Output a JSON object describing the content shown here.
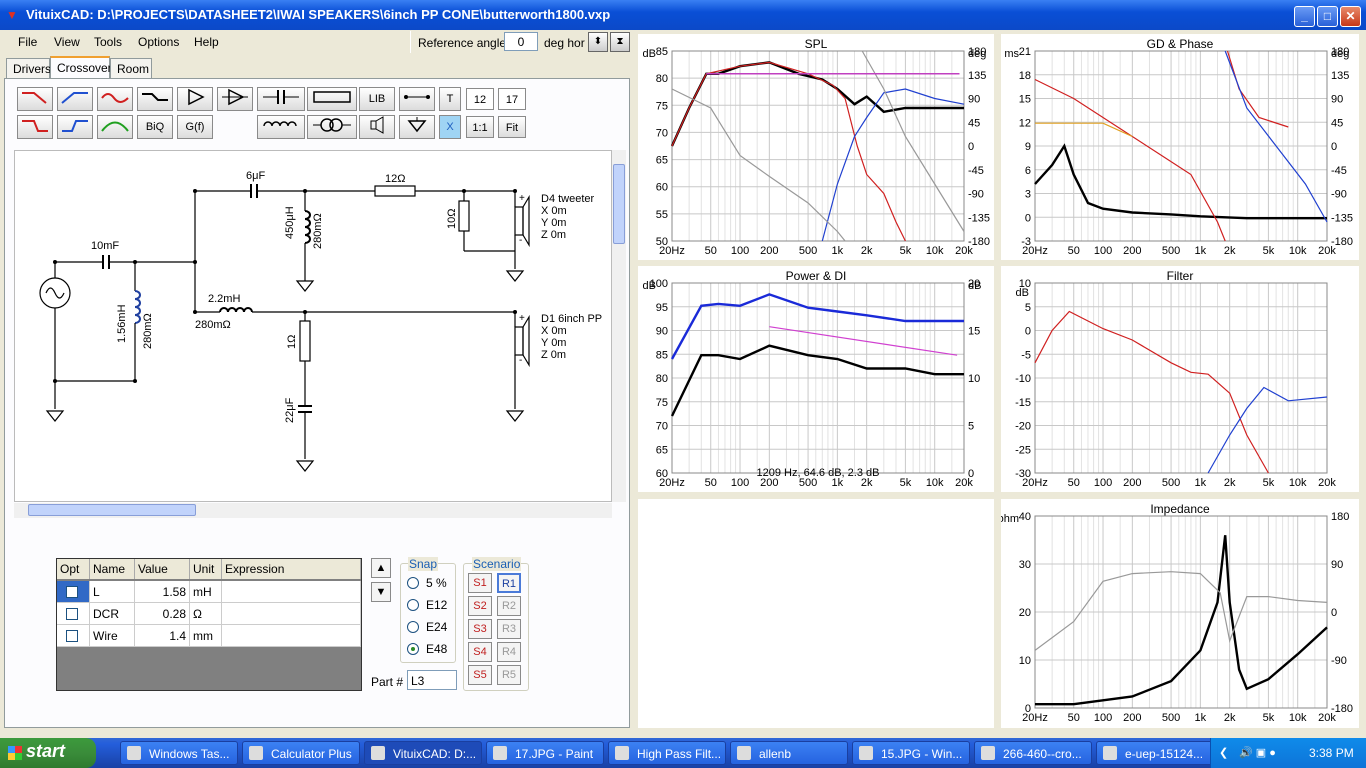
{
  "window": {
    "title": "VituixCAD: D:\\PROJECTS\\DATASHEET2\\IWAI SPEAKERS\\6inch PP CONE\\butterworth1800.vxp"
  },
  "menu": [
    "File",
    "View",
    "Tools",
    "Options",
    "Help"
  ],
  "reference": {
    "label": "Reference angle",
    "value": "0",
    "unit": "deg hor"
  },
  "tabs": [
    "Drivers",
    "Crossover",
    "Room"
  ],
  "toolbar": {
    "lib": "LIB",
    "t": "T",
    "n1": "12",
    "n2": "17",
    "biq": "BiQ",
    "gf": "G(f)",
    "x": "X",
    "ratio": "1:1",
    "fit": "Fit"
  },
  "schematic": {
    "labels": {
      "c1": "10mF",
      "l1": "1.56mH",
      "l1r": "280mΩ",
      "c2": "6μF",
      "l2": "450μH",
      "l2r": "280mΩ",
      "r1": "12Ω",
      "r2": "10Ω",
      "l3": "2.2mH",
      "l3r": "280mΩ",
      "r3": "1Ω",
      "c3": "22μF"
    },
    "driver1": {
      "name": "D4 tweeter",
      "x": "X 0m",
      "y": "Y 0m",
      "z": "Z 0m"
    },
    "driver2": {
      "name": "D1 6inch PP",
      "x": "X 0m",
      "y": "Y 0m",
      "z": "Z 0m"
    }
  },
  "parts": {
    "headers": [
      "Opt",
      "Name",
      "Value",
      "Unit",
      "Expression"
    ],
    "rows": [
      {
        "name": "L",
        "value": "1.58",
        "unit": "mH"
      },
      {
        "name": "DCR",
        "value": "0.28",
        "unit": "Ω"
      },
      {
        "name": "Wire",
        "value": "1.4",
        "unit": "mm"
      }
    ]
  },
  "snap": {
    "title": "Snap",
    "options": [
      "5 %",
      "E12",
      "E24",
      "E48"
    ],
    "selected": "E48"
  },
  "scenario": {
    "title": "Scenario",
    "s": [
      "S1",
      "S2",
      "S3",
      "S4",
      "S5"
    ],
    "r": [
      "R1",
      "R2",
      "R3",
      "R4",
      "R5"
    ]
  },
  "part_no": {
    "label": "Part #",
    "value": "L3"
  },
  "plots": {
    "spl": {
      "title": "SPL",
      "left_unit": "dB",
      "right_unit": "deg",
      "yleft": [
        "85",
        "80",
        "75",
        "70",
        "65",
        "60",
        "55",
        "50"
      ],
      "yright": [
        "180",
        "135",
        "90",
        "45",
        "0",
        "-45",
        "-90",
        "-135",
        "-180"
      ]
    },
    "gd": {
      "title": "GD & Phase",
      "left_unit": "ms",
      "right_unit": "deg",
      "yleft": [
        "21",
        "18",
        "15",
        "12",
        "9",
        "6",
        "3",
        "0",
        "-3"
      ],
      "yright": [
        "180",
        "135",
        "90",
        "45",
        "0",
        "-45",
        "-90",
        "-135",
        "-180"
      ]
    },
    "power": {
      "title": "Power & DI",
      "left_unit": "dB",
      "right_unit": "dB",
      "yleft": [
        "100",
        "95",
        "90",
        "85",
        "80",
        "75",
        "70",
        "65",
        "60"
      ],
      "yright": [
        "20",
        "15",
        "10",
        "5",
        "0"
      ],
      "readout": "1209 Hz, 64.6 dB, 2.3 dB"
    },
    "filter": {
      "title": "Filter",
      "left_unit": "dB",
      "yleft": [
        "10",
        "5",
        "0",
        "-5",
        "-10",
        "-15",
        "-20",
        "-25",
        "-30"
      ]
    },
    "impedance": {
      "title": "Impedance",
      "left_unit": "ohm",
      "yleft": [
        "40",
        "30",
        "20",
        "10",
        "0"
      ],
      "yright": [
        "180",
        "90",
        "0",
        "-90",
        "-180"
      ]
    },
    "xticks": [
      "20Hz",
      "50",
      "100",
      "200",
      "500",
      "1k",
      "2k",
      "5k",
      "10k",
      "20k"
    ]
  },
  "taskbar": {
    "start": "start",
    "tasks": [
      "Windows Tas...",
      "Calculator Plus",
      "VituixCAD: D:...",
      "17.JPG - Paint",
      "High Pass Filt...",
      "allenb",
      "15.JPG - Win...",
      "266-460--cro...",
      "e-uep-15124..."
    ],
    "clock": "3:38 PM"
  }
}
